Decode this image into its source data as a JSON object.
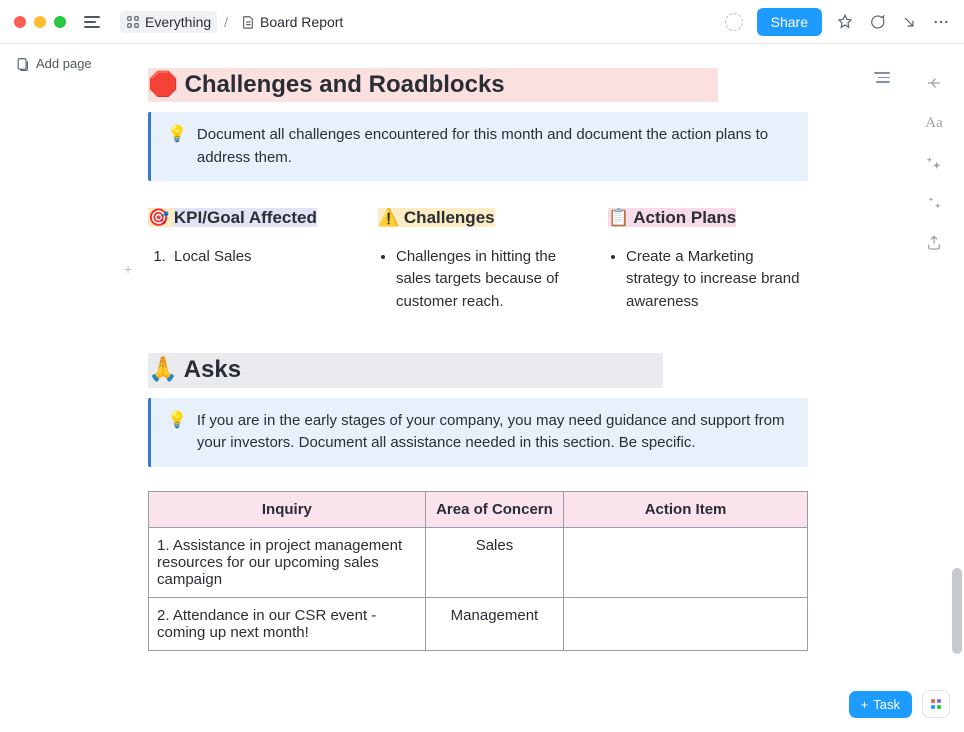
{
  "topbar": {
    "breadcrumb": {
      "root": "Everything",
      "page": "Board Report"
    },
    "share_label": "Share"
  },
  "sidebar": {
    "add_page_label": "Add page"
  },
  "section_challenges": {
    "emoji": "🛑",
    "title": "Challenges and Roadblocks",
    "callout_icon": "💡",
    "callout_text": "Document all challenges encountered for this month and document the action plans to address them.",
    "columns": [
      {
        "emoji": "🎯",
        "title": "KPI/Goal Affected",
        "items": [
          "Local Sales"
        ]
      },
      {
        "emoji": "⚠️",
        "title": "Challenges",
        "items": [
          "Challenges in hitting the sales targets because of customer reach."
        ]
      },
      {
        "emoji": "📋",
        "title": "Action Plans",
        "items": [
          "Create a Marketing strategy to increase brand awareness"
        ]
      }
    ]
  },
  "section_asks": {
    "emoji": "🙏",
    "title": "Asks",
    "callout_icon": "💡",
    "callout_text": "If you are in the early stages of your company, you may need guidance and support from your investors. Document all assistance needed in this section. Be specific.",
    "table": {
      "headers": [
        "Inquiry",
        "Area of Concern",
        "Action Item"
      ],
      "rows": [
        {
          "inquiry": "1. Assistance in project management resources for our upcoming sales campaign",
          "area": "Sales",
          "action": ""
        },
        {
          "inquiry": "2. Attendance in our CSR event - coming up next month!",
          "area": "Management",
          "action": ""
        }
      ]
    }
  },
  "bottom": {
    "task_label": "Task"
  }
}
